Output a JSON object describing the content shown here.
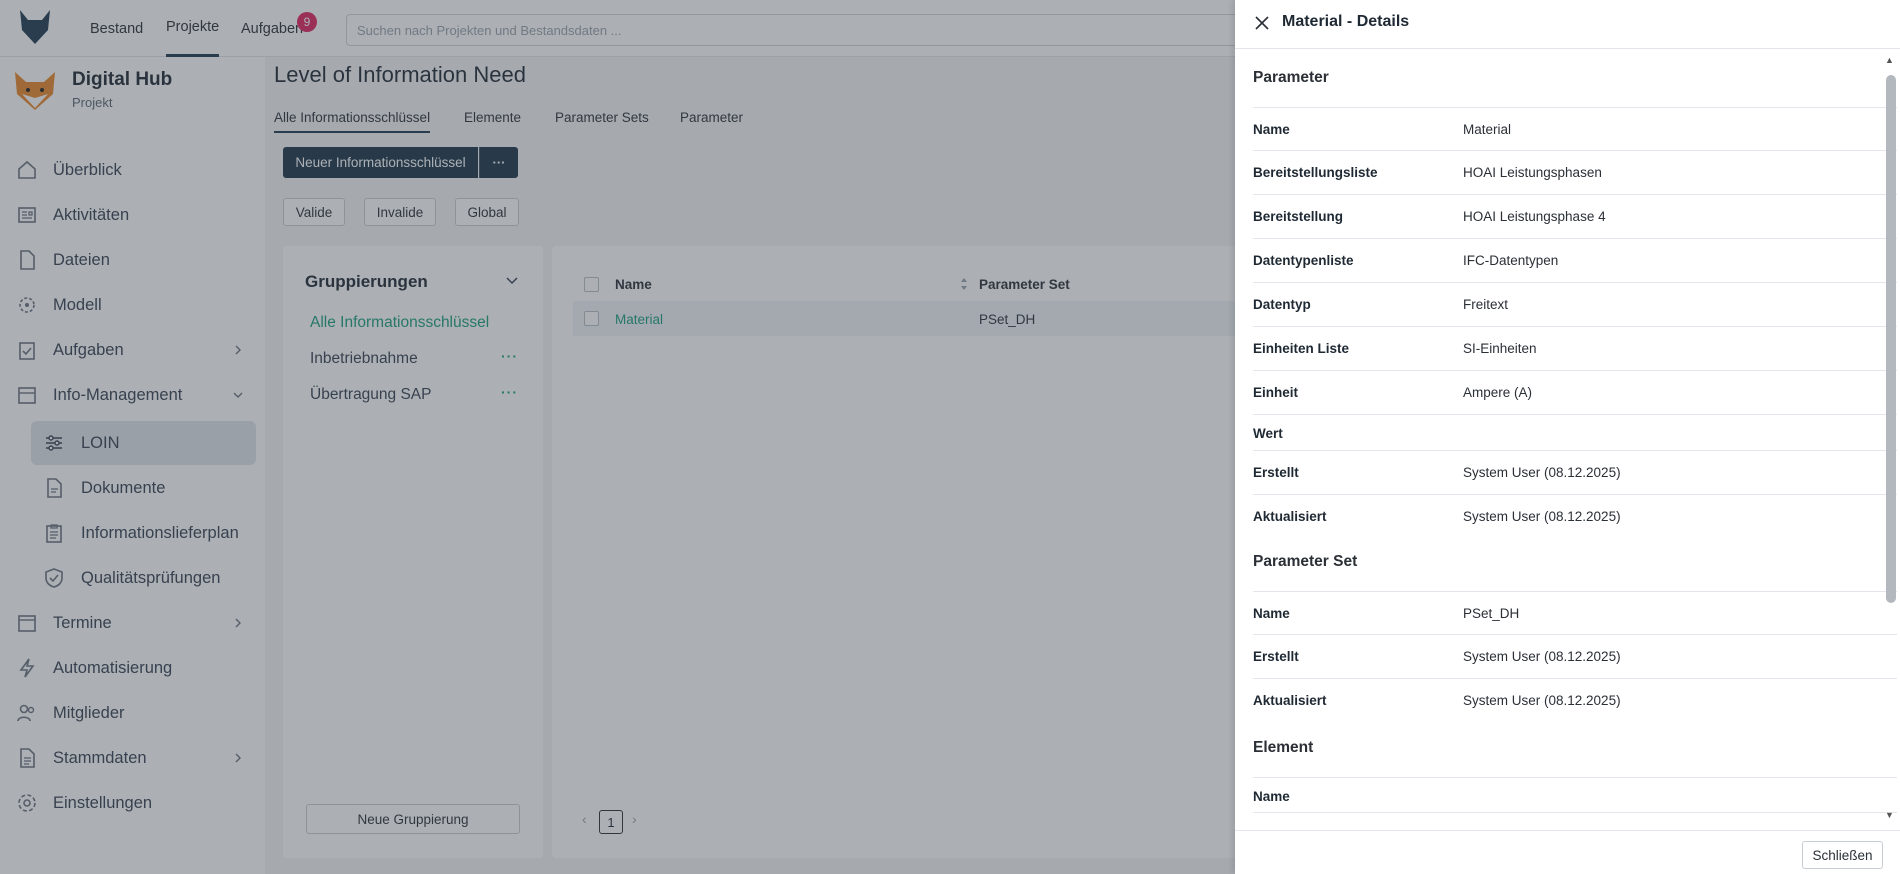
{
  "topbar": {
    "nav": [
      {
        "label": "Bestand"
      },
      {
        "label": "Projekte"
      },
      {
        "label": "Aufgaben"
      }
    ],
    "tasks_badge": "9",
    "search_placeholder": "Suchen nach Projekten und Bestandsdaten ..."
  },
  "sidebar": {
    "hub_title": "Digital Hub",
    "hub_subtitle": "Projekt",
    "items": [
      {
        "label": "Überblick",
        "icon": "home-icon"
      },
      {
        "label": "Aktivitäten",
        "icon": "activity-icon"
      },
      {
        "label": "Dateien",
        "icon": "file-icon"
      },
      {
        "label": "Modell",
        "icon": "model-icon"
      },
      {
        "label": "Aufgaben",
        "icon": "task-icon"
      },
      {
        "label": "Info-Management",
        "icon": "inbox-icon"
      },
      {
        "label": "LOIN",
        "icon": "sliders-icon"
      },
      {
        "label": "Dokumente",
        "icon": "document-icon"
      },
      {
        "label": "Informationslieferplan",
        "icon": "clipboard-icon"
      },
      {
        "label": "Qualitätsprüfungen",
        "icon": "shield-check-icon"
      },
      {
        "label": "Termine",
        "icon": "calendar-icon"
      },
      {
        "label": "Automatisierung",
        "icon": "lightning-icon"
      },
      {
        "label": "Mitglieder",
        "icon": "users-icon"
      },
      {
        "label": "Stammdaten",
        "icon": "database-icon"
      },
      {
        "label": "Einstellungen",
        "icon": "gear-icon"
      }
    ]
  },
  "main": {
    "title": "Level of Information Need",
    "tabs": [
      {
        "label": "Alle Informationsschlüssel"
      },
      {
        "label": "Elemente"
      },
      {
        "label": "Parameter Sets"
      },
      {
        "label": "Parameter"
      }
    ],
    "new_button": "Neuer Informationsschlüssel",
    "more_button": "···",
    "filters": [
      {
        "label": "Valide"
      },
      {
        "label": "Invalide"
      },
      {
        "label": "Global"
      }
    ],
    "groups": {
      "title": "Gruppierungen",
      "items": [
        {
          "label": "Alle Informationsschlüssel"
        },
        {
          "label": "Inbetriebnahme"
        },
        {
          "label": "Übertragung SAP"
        }
      ],
      "dots": "···",
      "new_group_button": "Neue Gruppierung"
    },
    "table": {
      "columns": [
        "Name",
        "Parameter Set"
      ],
      "rows": [
        {
          "name": "Material",
          "parameter_set": "PSet_DH"
        }
      ],
      "page": "1"
    }
  },
  "drawer": {
    "title": "Material - Details",
    "sections": [
      {
        "title": "Parameter",
        "rows": [
          {
            "key": "Name",
            "value": "Material"
          },
          {
            "key": "Bereitstellungsliste",
            "value": "HOAI Leistungsphasen"
          },
          {
            "key": "Bereitstellung",
            "value": "HOAI Leistungsphase 4"
          },
          {
            "key": "Datentypenliste",
            "value": "IFC-Datentypen"
          },
          {
            "key": "Datentyp",
            "value": "Freitext"
          },
          {
            "key": "Einheiten Liste",
            "value": "SI-Einheiten"
          },
          {
            "key": "Einheit",
            "value": "Ampere (A)"
          },
          {
            "key": "Wert",
            "value": ""
          },
          {
            "key": "Erstellt",
            "value": "System User (08.12.2025)"
          },
          {
            "key": "Aktualisiert",
            "value": "System User (08.12.2025)"
          }
        ]
      },
      {
        "title": "Parameter Set",
        "rows": [
          {
            "key": "Name",
            "value": "PSet_DH"
          },
          {
            "key": "Erstellt",
            "value": "System User (08.12.2025)"
          },
          {
            "key": "Aktualisiert",
            "value": "System User (08.12.2025)"
          }
        ]
      },
      {
        "title": "Element",
        "rows": [
          {
            "key": "Name",
            "value": ""
          }
        ]
      }
    ],
    "close_button": "Schließen"
  },
  "colors": {
    "primary": "#1c3549",
    "accent": "#1a9e7c",
    "badge": "#e0245e"
  }
}
